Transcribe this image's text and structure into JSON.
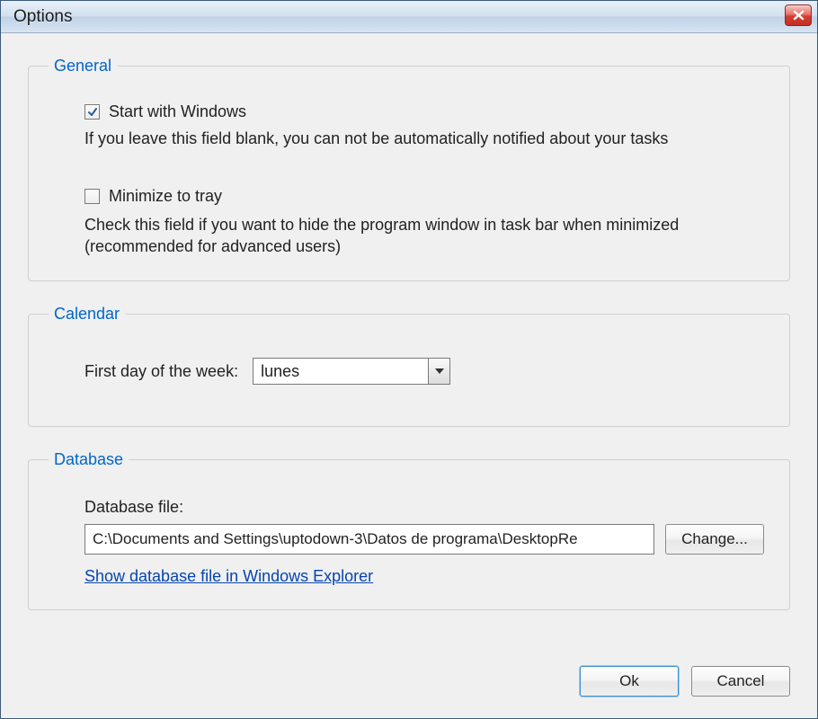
{
  "window": {
    "title": "Options"
  },
  "general": {
    "legend": "General",
    "start_with_windows": {
      "label": "Start with Windows",
      "checked": true,
      "desc": "If you leave this field blank, you can not be automatically notified about your tasks"
    },
    "minimize_to_tray": {
      "label": "Minimize to tray",
      "checked": false,
      "desc": "Check this field if you want to hide the program window in task bar when minimized (recommended for advanced users)"
    }
  },
  "calendar": {
    "legend": "Calendar",
    "first_day_label": "First day of the week:",
    "first_day_value": "lunes"
  },
  "database": {
    "legend": "Database",
    "file_label": "Database file:",
    "file_value": "C:\\Documents and Settings\\uptodown-3\\Datos de programa\\DesktopRe",
    "change_label": "Change...",
    "show_link": "Show database file in Windows Explorer"
  },
  "buttons": {
    "ok": "Ok",
    "cancel": "Cancel"
  }
}
